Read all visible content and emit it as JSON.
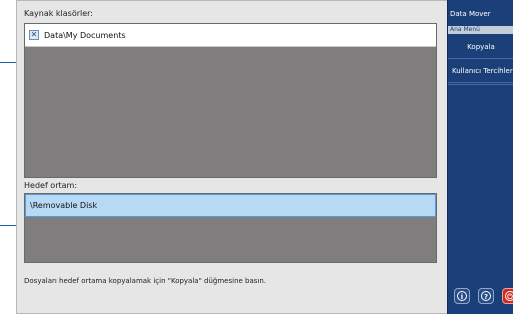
{
  "source": {
    "label": "Kaynak klasörler:",
    "items": [
      {
        "label": "Data\\My Documents",
        "icon": "remove-x-icon"
      }
    ]
  },
  "target": {
    "label": "Hedef ortam:",
    "items": [
      {
        "label": "\\Removable Disk"
      }
    ]
  },
  "hint": "Dosyaları hedef ortama kopyalamak için \"Kopyala\" düğmesine basın.",
  "panel": {
    "title": "Data Mover",
    "subtitle": "Ana Menü",
    "buttons": [
      {
        "label": "Kopyala"
      },
      {
        "label": "Kullanıcı Tercihleri"
      }
    ],
    "bottom_buttons": [
      {
        "icon": "info-icon",
        "glyph": "i"
      },
      {
        "icon": "help-icon",
        "glyph": "?"
      },
      {
        "icon": "exit-icon",
        "glyph": "⏻"
      }
    ]
  },
  "colors": {
    "panel": "#1b3f78",
    "selected_row": "#b8d9f4",
    "list_bg": "#7f7d7e"
  }
}
